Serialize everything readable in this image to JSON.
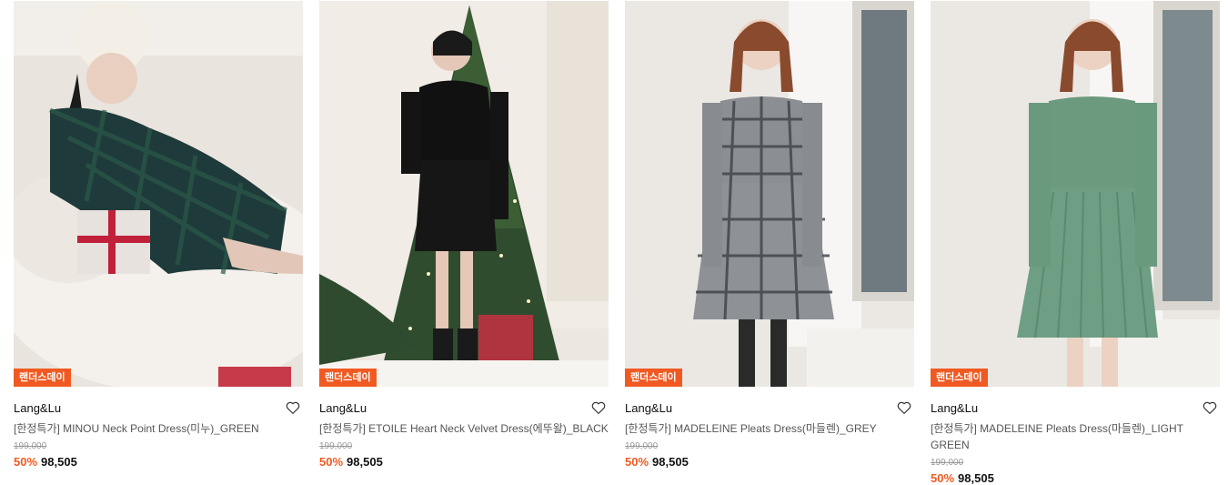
{
  "products": [
    {
      "badge": "랜더스데이",
      "brand": "Lang&Lu",
      "name": "[한정특가] MINOU Neck Point Dress(미누)_GREEN",
      "original_price": "199,000",
      "discount": "50%",
      "price": "98,505",
      "image_tone": "green-tartan"
    },
    {
      "badge": "랜더스데이",
      "brand": "Lang&Lu",
      "name": "[한정특가] ETOILE Heart Neck Velvet Dress(에뚜왈)_BLACK",
      "original_price": "199,000",
      "discount": "50%",
      "price": "98,505",
      "image_tone": "black-velvet"
    },
    {
      "badge": "랜더스데이",
      "brand": "Lang&Lu",
      "name": "[한정특가] MADELEINE Pleats Dress(마들렌)_GREY",
      "original_price": "199,000",
      "discount": "50%",
      "price": "98,505",
      "image_tone": "grey-plaid"
    },
    {
      "badge": "랜더스데이",
      "brand": "Lang&Lu",
      "name": "[한정특가] MADELEINE Pleats Dress(마들렌)_LIGHT GREEN",
      "original_price": "199,000",
      "discount": "50%",
      "price": "98,505",
      "image_tone": "light-green"
    }
  ],
  "colors": {
    "accent": "#f05a22",
    "text": "#111111",
    "muted": "#999999"
  },
  "icons": {
    "wishlist": "heart-outline-icon"
  }
}
